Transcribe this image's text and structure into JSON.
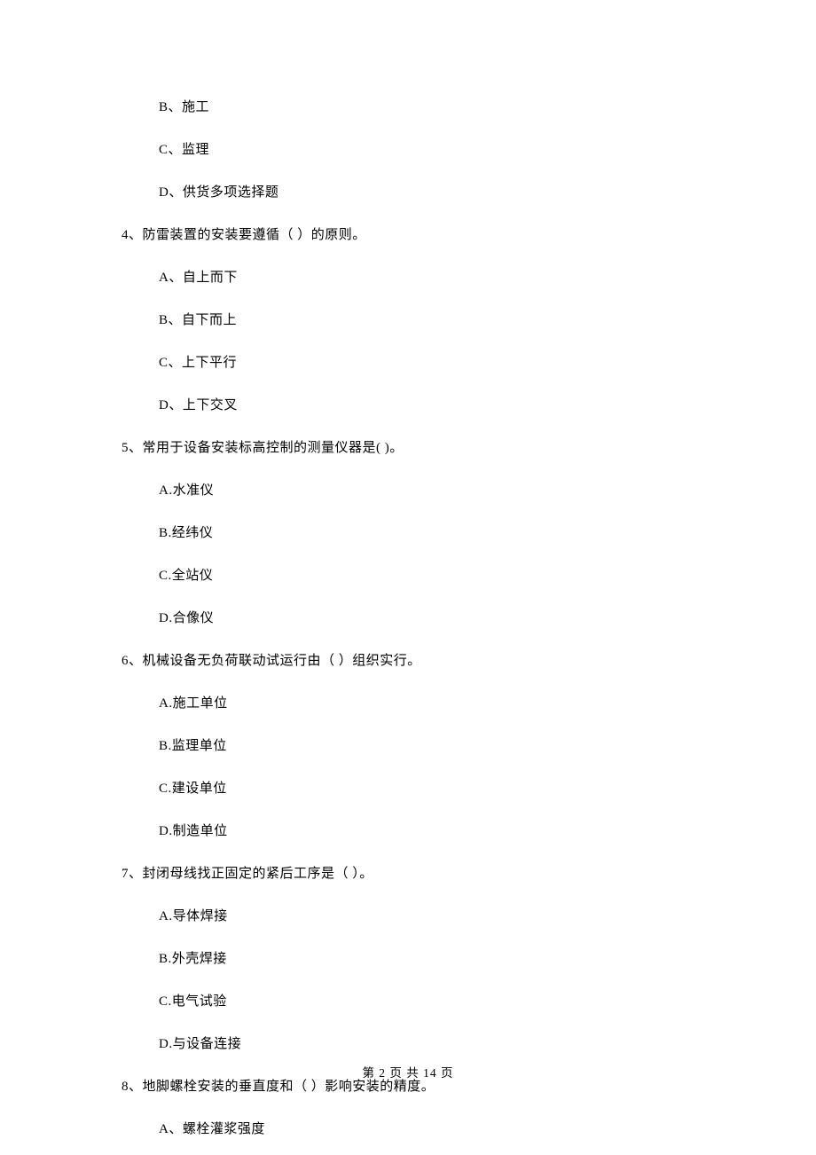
{
  "q3_optB": "B、施工",
  "q3_optC": "C、监理",
  "q3_optD": "D、供货多项选择题",
  "q4": "4、防雷装置的安装要遵循（   ）的原则。",
  "q4_optA": "A、自上而下",
  "q4_optB": "B、自下而上",
  "q4_optC": "C、上下平行",
  "q4_optD": "D、上下交叉",
  "q5": "5、常用于设备安装标高控制的测量仪器是(   )。",
  "q5_optA": "A.水准仪",
  "q5_optB": "B.经纬仪",
  "q5_optC": "C.全站仪",
  "q5_optD": "D.合像仪",
  "q6": "6、机械设备无负荷联动试运行由（   ）组织实行。",
  "q6_optA": "A.施工单位",
  "q6_optB": "B.监理单位",
  "q6_optC": "C.建设单位",
  "q6_optD": "D.制造单位",
  "q7": "7、封闭母线找正固定的紧后工序是（   ）。",
  "q7_optA": "A.导体焊接",
  "q7_optB": "B.外壳焊接",
  "q7_optC": "C.电气试验",
  "q7_optD": "D.与设备连接",
  "q8": "8、地脚螺栓安装的垂直度和（   ）影响安装的精度。",
  "q8_optA": "A、螺栓灌浆强度",
  "page_num": "第 2 页 共 14 页"
}
